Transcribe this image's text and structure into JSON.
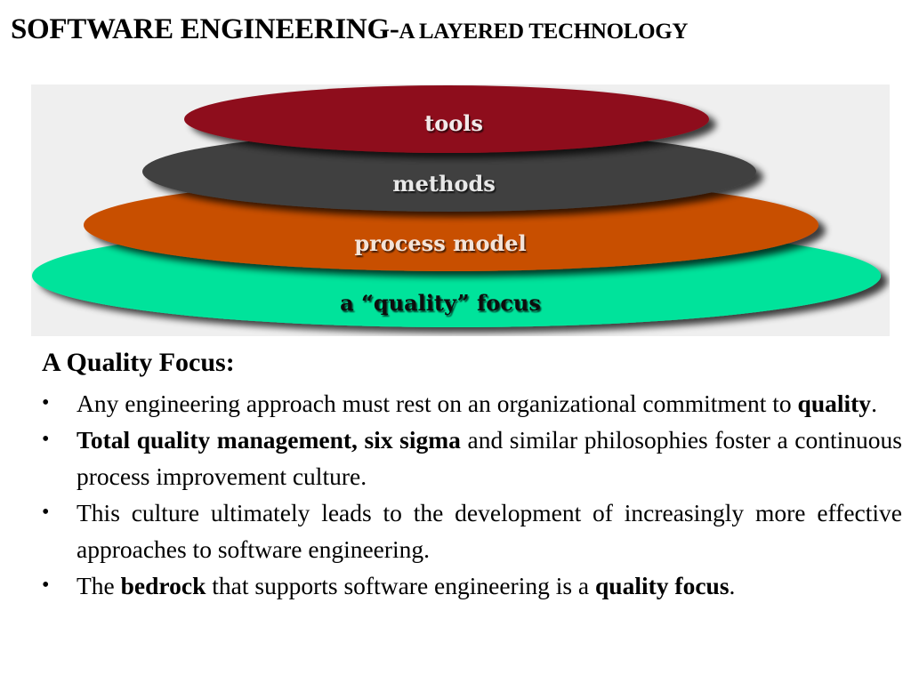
{
  "title": {
    "part1": "SOFTWARE ENGINEERING-",
    "part2": "A LAYERED TECHNOLOGY"
  },
  "diagram": {
    "background_color": "#efefef",
    "layers": [
      {
        "id": "tools",
        "label": "tools",
        "color": "#8e111c",
        "text_color": "#f2e9e9"
      },
      {
        "id": "methods",
        "label": "methods",
        "color": "#3f3f3f",
        "text_color": "#e8e8e8"
      },
      {
        "id": "process-model",
        "label": "process model",
        "color": "#c84f00",
        "text_color": "#f3e3d8"
      },
      {
        "id": "quality-focus",
        "label": "a “quality” focus",
        "color": "#00e39b",
        "text_color": "#111111"
      }
    ]
  },
  "content": {
    "heading": "A Quality Focus:",
    "bullet_char": "•",
    "bullets": [
      {
        "segments": [
          {
            "text": "Any engineering approach must rest on an organizational commitment to ",
            "bold": false
          },
          {
            "text": "quality",
            "bold": true
          },
          {
            "text": ".",
            "bold": false
          }
        ]
      },
      {
        "segments": [
          {
            "text": "Total quality management, six sigma",
            "bold": true
          },
          {
            "text": " and similar philosophies foster a continuous process improvement culture.",
            "bold": false
          }
        ]
      },
      {
        "segments": [
          {
            "text": "This culture ultimately leads to the development of increasingly more effective approaches to software engineering.",
            "bold": false
          }
        ]
      },
      {
        "segments": [
          {
            "text": "The ",
            "bold": false
          },
          {
            "text": "bedrock",
            "bold": true
          },
          {
            "text": " that supports software engineering is a ",
            "bold": false
          },
          {
            "text": "quality focus",
            "bold": true
          },
          {
            "text": ".",
            "bold": false
          }
        ]
      }
    ]
  }
}
